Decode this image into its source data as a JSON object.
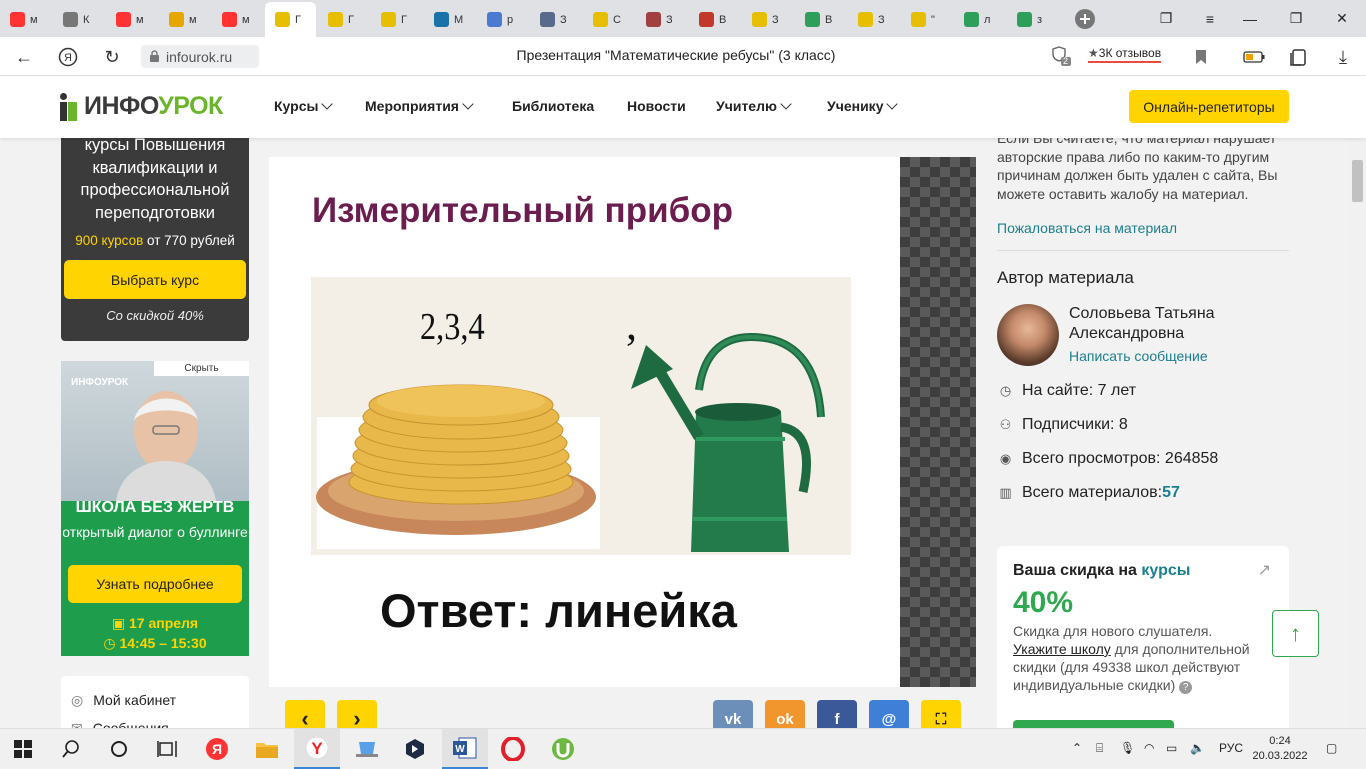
{
  "browser": {
    "tabs": [
      {
        "icon": "yandex-icon",
        "label": "м",
        "color": "#f33"
      },
      {
        "icon": "infourok-icon",
        "label": "К",
        "color": "#777"
      },
      {
        "icon": "yandex-icon",
        "label": "м",
        "color": "#f33"
      },
      {
        "icon": "image-icon",
        "label": "м",
        "color": "#e6a800"
      },
      {
        "icon": "yandex-icon",
        "label": "м",
        "color": "#f33"
      },
      {
        "icon": "infourok-icon",
        "label": "Г",
        "color": "#e6c000"
      },
      {
        "icon": "infourok-icon",
        "label": "Г",
        "color": "#e6c000"
      },
      {
        "icon": "infourok-icon",
        "label": "Г",
        "color": "#e6c000"
      },
      {
        "icon": "k-icon",
        "label": "М",
        "color": "#1a73a8"
      },
      {
        "icon": "doc-icon",
        "label": "р",
        "color": "#4a7bd0"
      },
      {
        "icon": "shield-icon",
        "label": "З",
        "color": "#5a6a8a"
      },
      {
        "icon": "infourok-icon",
        "label": "С",
        "color": "#e6c000"
      },
      {
        "icon": "heart-icon",
        "label": "З",
        "color": "#a04040"
      },
      {
        "icon": "briefcase-icon",
        "label": "В",
        "color": "#c0392b"
      },
      {
        "icon": "infourok-icon",
        "label": "З",
        "color": "#e6c000"
      },
      {
        "icon": "check-icon",
        "label": "В",
        "color": "#2e9e5b"
      },
      {
        "icon": "infourok-icon",
        "label": "З",
        "color": "#e6c000"
      },
      {
        "icon": "infourok-icon",
        "label": "\"",
        "color": "#e6c000"
      },
      {
        "icon": "check-icon",
        "label": "л",
        "color": "#2e9e5b"
      },
      {
        "icon": "check-icon",
        "label": "з",
        "color": "#2e9e5b"
      }
    ],
    "url": "infourok.ru",
    "page_title": "Презентация \"Математические ребусы\" (3 класс)",
    "reviews": "3К отзывов",
    "tab_badge": "2"
  },
  "site": {
    "logo_a": "ИНФО",
    "logo_b": "УРОК",
    "nav": [
      "Курсы",
      "Мероприятия",
      "Библиотека",
      "Новости",
      "Учителю",
      "Ученику"
    ],
    "tutors": "Онлайн-репетиторы"
  },
  "ad1": {
    "title": "курсы Повышения квалификации и профессиональной переподготовки",
    "price_hl": "900 курсов",
    "price_rest": " от 770 рублей",
    "button": "Выбрать курс",
    "discount": "Со скидкой 40%"
  },
  "ad2": {
    "hide": "Скрыть",
    "brand": "ИНФОУРОК",
    "headline": "ШКОЛА БЕЗ ЖЕРТВ",
    "sub": "открытый диалог о буллинге",
    "button": "Узнать подробнее",
    "date": "17 апреля",
    "time": "14:45 – 15:30"
  },
  "left_menu": [
    "Мой кабинет",
    "Сообщения"
  ],
  "slide": {
    "title": "Измерительный прибор",
    "numbers": "2,3,4",
    "comma": ",",
    "answer": "Ответ: линейка"
  },
  "share": {
    "vk": "vk",
    "ok": "ok",
    "fb": "f",
    "mail": "@"
  },
  "right": {
    "complaint": "Если Вы считаете, что материал нарушает авторские права либо по каким-то другим причинам должен быть удален с сайта, Вы можете оставить жалобу на материал.",
    "complaint_link": "Пожаловаться на материал",
    "author_header": "Автор материала",
    "author_name": "Соловьева Татьяна Александровна",
    "message": "Написать сообщение",
    "stats": {
      "on_site": "На сайте: 7 лет",
      "subscribers": "Подписчики: 8",
      "views": "Всего просмотров: 264858",
      "materials_label": "Всего материалов: ",
      "materials_count": "57"
    },
    "promo": {
      "title": "Ваша скидка на ",
      "title_link": "курсы",
      "percent": "40%",
      "text1": "Скидка для нового слушателя.",
      "link": "Укажите школу",
      "text2": " для дополнительной скидки (для 49338 школ действуют индивидуальные скидки)"
    }
  },
  "taskbar": {
    "lang": "РУС",
    "time": "0:24",
    "date": "20.03.2022"
  }
}
